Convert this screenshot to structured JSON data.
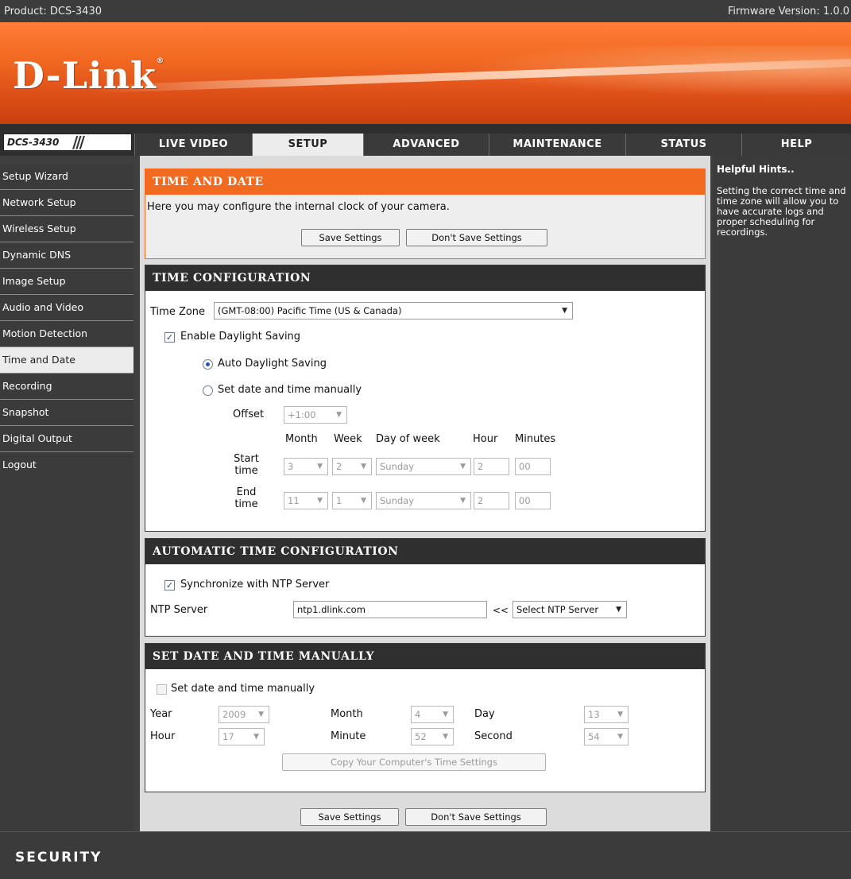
{
  "topbar": {
    "product": "Product: DCS-3430",
    "firmware": "Firmware Version: 1.0.0"
  },
  "brand": {
    "logo": "D-Link",
    "model_badge": "DCS-3430"
  },
  "tabs": [
    {
      "label": "LIVE VIDEO"
    },
    {
      "label": "SETUP"
    },
    {
      "label": "ADVANCED"
    },
    {
      "label": "MAINTENANCE"
    },
    {
      "label": "STATUS"
    },
    {
      "label": "HELP"
    }
  ],
  "sidebar": {
    "items": [
      {
        "label": "Setup Wizard"
      },
      {
        "label": "Network Setup"
      },
      {
        "label": "Wireless Setup"
      },
      {
        "label": "Dynamic DNS"
      },
      {
        "label": "Image Setup"
      },
      {
        "label": "Audio and Video"
      },
      {
        "label": "Motion Detection"
      },
      {
        "label": "Time and Date"
      },
      {
        "label": "Recording"
      },
      {
        "label": "Snapshot"
      },
      {
        "label": "Digital Output"
      },
      {
        "label": "Logout"
      }
    ]
  },
  "hints": {
    "title": "Helpful Hints..",
    "text": "Setting the correct time and time zone will allow you to have accurate logs and proper scheduling for recordings."
  },
  "time_and_date": {
    "title": "TIME AND DATE",
    "description": "Here you may configure the internal clock of your camera.",
    "save": "Save Settings",
    "dont_save": "Don't Save Settings"
  },
  "time_config": {
    "title": "TIME CONFIGURATION",
    "time_zone_label": "Time Zone",
    "time_zone_value": "(GMT-08:00) Pacific Time (US & Canada)",
    "enable_dst": "Enable Daylight Saving",
    "auto_dst": "Auto Daylight Saving",
    "manual_dst": "Set date and time manually",
    "offset_label": "Offset",
    "offset_value": "+1:00",
    "col_month": "Month",
    "col_week": "Week",
    "col_dow": "Day of week",
    "col_hour": "Hour",
    "col_minutes": "Minutes",
    "start_label_1": "Start",
    "start_label_2": "time",
    "end_label_1": "End",
    "end_label_2": "time",
    "start": {
      "month": "3",
      "week": "2",
      "dow": "Sunday",
      "hour": "2",
      "minutes": "00"
    },
    "end": {
      "month": "11",
      "week": "1",
      "dow": "Sunday",
      "hour": "2",
      "minutes": "00"
    }
  },
  "auto_time": {
    "title": "AUTOMATIC TIME CONFIGURATION",
    "sync_label": "Synchronize with NTP Server",
    "ntp_label": "NTP Server",
    "ntp_value": "ntp1.dlink.com",
    "arrows": "<<",
    "select_ntp": "Select NTP Server"
  },
  "manual_time": {
    "title": "SET DATE AND TIME MANUALLY",
    "checkbox_label": "Set date and time manually",
    "year_label": "Year",
    "year_value": "2009",
    "month_label": "Month",
    "month_value": "4",
    "day_label": "Day",
    "day_value": "13",
    "hour_label": "Hour",
    "hour_value": "17",
    "minute_label": "Minute",
    "minute_value": "52",
    "second_label": "Second",
    "second_value": "54",
    "copy_button": "Copy Your Computer's Time Settings"
  },
  "bottom_buttons": {
    "save": "Save Settings",
    "dont_save": "Don't Save Settings"
  },
  "footer": {
    "label": "SECURITY"
  }
}
